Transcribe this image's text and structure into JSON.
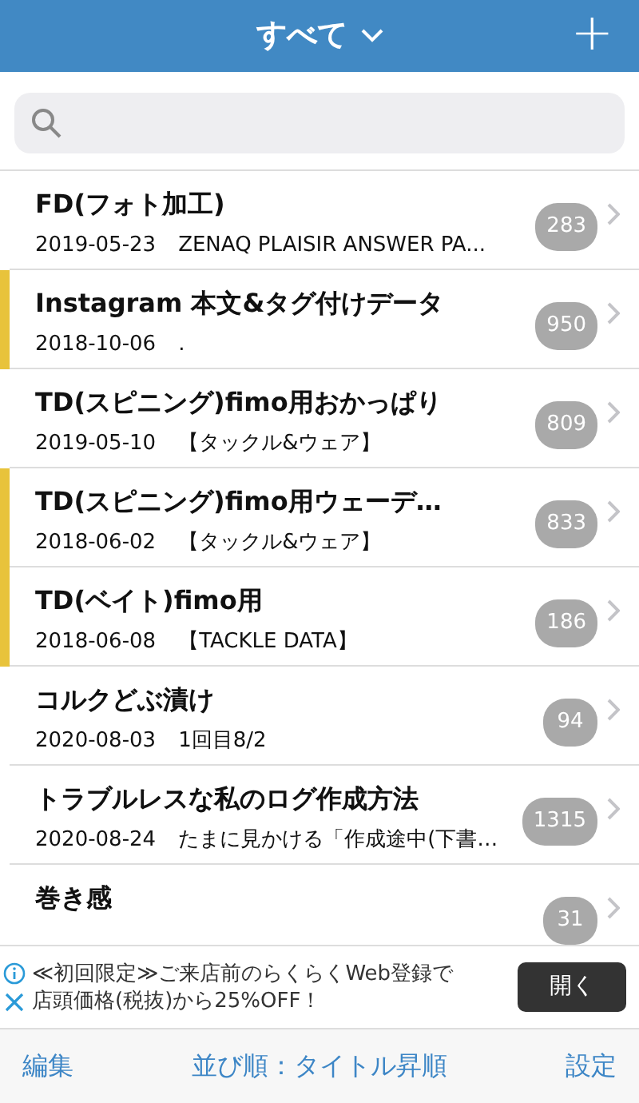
{
  "header": {
    "title": "すべて",
    "add_button": "+"
  },
  "notes": [
    {
      "title": "FD(フォト加工)",
      "date": "2019-05-23",
      "preview": "ZENAQ PLAISIR ANSWER PA...",
      "count": "283",
      "marked": false
    },
    {
      "title": "Instagram 本文&タグ付けデータ",
      "date": "2018-10-06",
      "preview": ".",
      "count": "950",
      "marked": true
    },
    {
      "title": "TD(スピニング)fimo用おかっぱり",
      "date": "2019-05-10",
      "preview": "【タックル&ウェア】",
      "count": "809",
      "marked": false
    },
    {
      "title": "TD(スピニング)fimo用ウェーデ…",
      "date": "2018-06-02",
      "preview": "【タックル&ウェア】",
      "count": "833",
      "marked": true
    },
    {
      "title": "TD(ベイト)fimo用",
      "date": "2018-06-08",
      "preview": "【TACKLE DATA】",
      "count": "186",
      "marked": true
    },
    {
      "title": "コルクどぶ漬け",
      "date": "2020-08-03",
      "preview": "1回目8/2",
      "count": "94",
      "marked": false
    },
    {
      "title": "トラブルレスな私のログ作成方法",
      "date": "2020-08-24",
      "preview": "たまに見かける「作成途中(下書…",
      "count": "1315",
      "marked": false
    },
    {
      "title": "巻き感",
      "count": "31",
      "marked": false
    }
  ],
  "ad": {
    "text": "≪初回限定≫ご来店前のらくらくWeb登録で店頭価格(税抜)から25%OFF！",
    "button": "開く"
  },
  "toolbar": {
    "left": "編集",
    "center": "並び順：タイトル昇順",
    "right": "設定"
  }
}
